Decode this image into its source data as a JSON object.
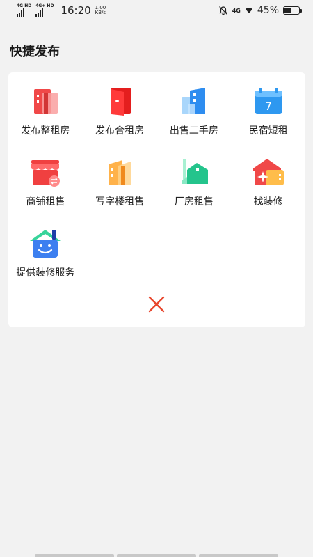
{
  "status_bar": {
    "net1": "4G HD",
    "net2": "4G+ HD",
    "time": "16:20",
    "speed_value": "1.00",
    "speed_unit": "KB/s",
    "net3": "4G",
    "battery": "45%"
  },
  "page": {
    "title": "快捷发布"
  },
  "items": [
    {
      "label": "发布整租房",
      "icon": "whole-rent-icon"
    },
    {
      "label": "发布合租房",
      "icon": "shared-rent-door-icon"
    },
    {
      "label": "出售二手房",
      "icon": "second-hand-house-icon"
    },
    {
      "label": "民宿短租",
      "icon": "calendar-icon"
    },
    {
      "label": "商铺租售",
      "icon": "shop-icon"
    },
    {
      "label": "写字楼租售",
      "icon": "office-building-icon"
    },
    {
      "label": "厂房租售",
      "icon": "factory-icon"
    },
    {
      "label": "找装修",
      "icon": "renovation-icon"
    },
    {
      "label": "提供装修服务",
      "icon": "smiling-house-icon"
    }
  ],
  "colors": {
    "close": "#e8452c",
    "card": "#ffffff",
    "background": "#f2f2f2"
  }
}
